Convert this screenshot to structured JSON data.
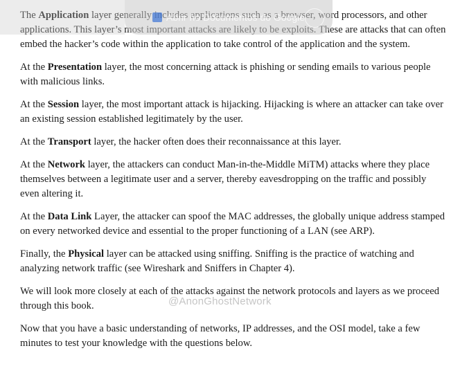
{
  "overlay": {
    "tab_title": "Abrir no Documentos do Google"
  },
  "watermark": "@AnonGhostNetwork",
  "paragraphs": [
    {
      "pre": "The ",
      "bold": "Application",
      "post": " layer generally includes applications such as a browser, word processors, and other applications.  This layer’s most important attacks are likely to be exploits. These are attacks that can often embed the hacker’s code within the application to take control of the application and the system."
    },
    {
      "pre": "At the ",
      "bold": "Presentation",
      "post": " layer, the most concerning attack is phishing or sending emails to various people with malicious links."
    },
    {
      "pre": "At the ",
      "bold": "Session",
      "post": " layer, the most important attack is hijacking. Hijacking is where an attacker can take over an existing session established legitimately by the user."
    },
    {
      "pre": "At the ",
      "bold": "Transport",
      "post": " layer, the hacker often does their reconnaissance at this layer."
    },
    {
      "pre": "At the ",
      "bold": "Network",
      "post": " layer, the attackers can conduct Man-in-the-Middle MiTM) attacks where they place themselves between a legitimate user and a server, thereby eavesdropping on the traffic and possibly even altering it."
    },
    {
      "pre": "At the ",
      "bold": "Data Link",
      "post": " Layer, the attacker can spoof the MAC addresses, the globally unique address stamped on every networked device and essential to the proper functioning of a LAN (see ARP)."
    },
    {
      "pre": "Finally, the ",
      "bold": "Physical",
      "post": " layer can be attacked using sniffing. Sniffing is the practice of watching and analyzing network traffic (see Wireshark and Sniffers in Chapter 4)."
    },
    {
      "pre": "We will look more closely at each of the attacks against the network protocols and layers as we proceed through this book.",
      "bold": "",
      "post": ""
    },
    {
      "pre": "Now that you have a basic understanding of networks, IP addresses, and the OSI model, take a few minutes to test your knowledge with the questions below.",
      "bold": "",
      "post": ""
    }
  ]
}
